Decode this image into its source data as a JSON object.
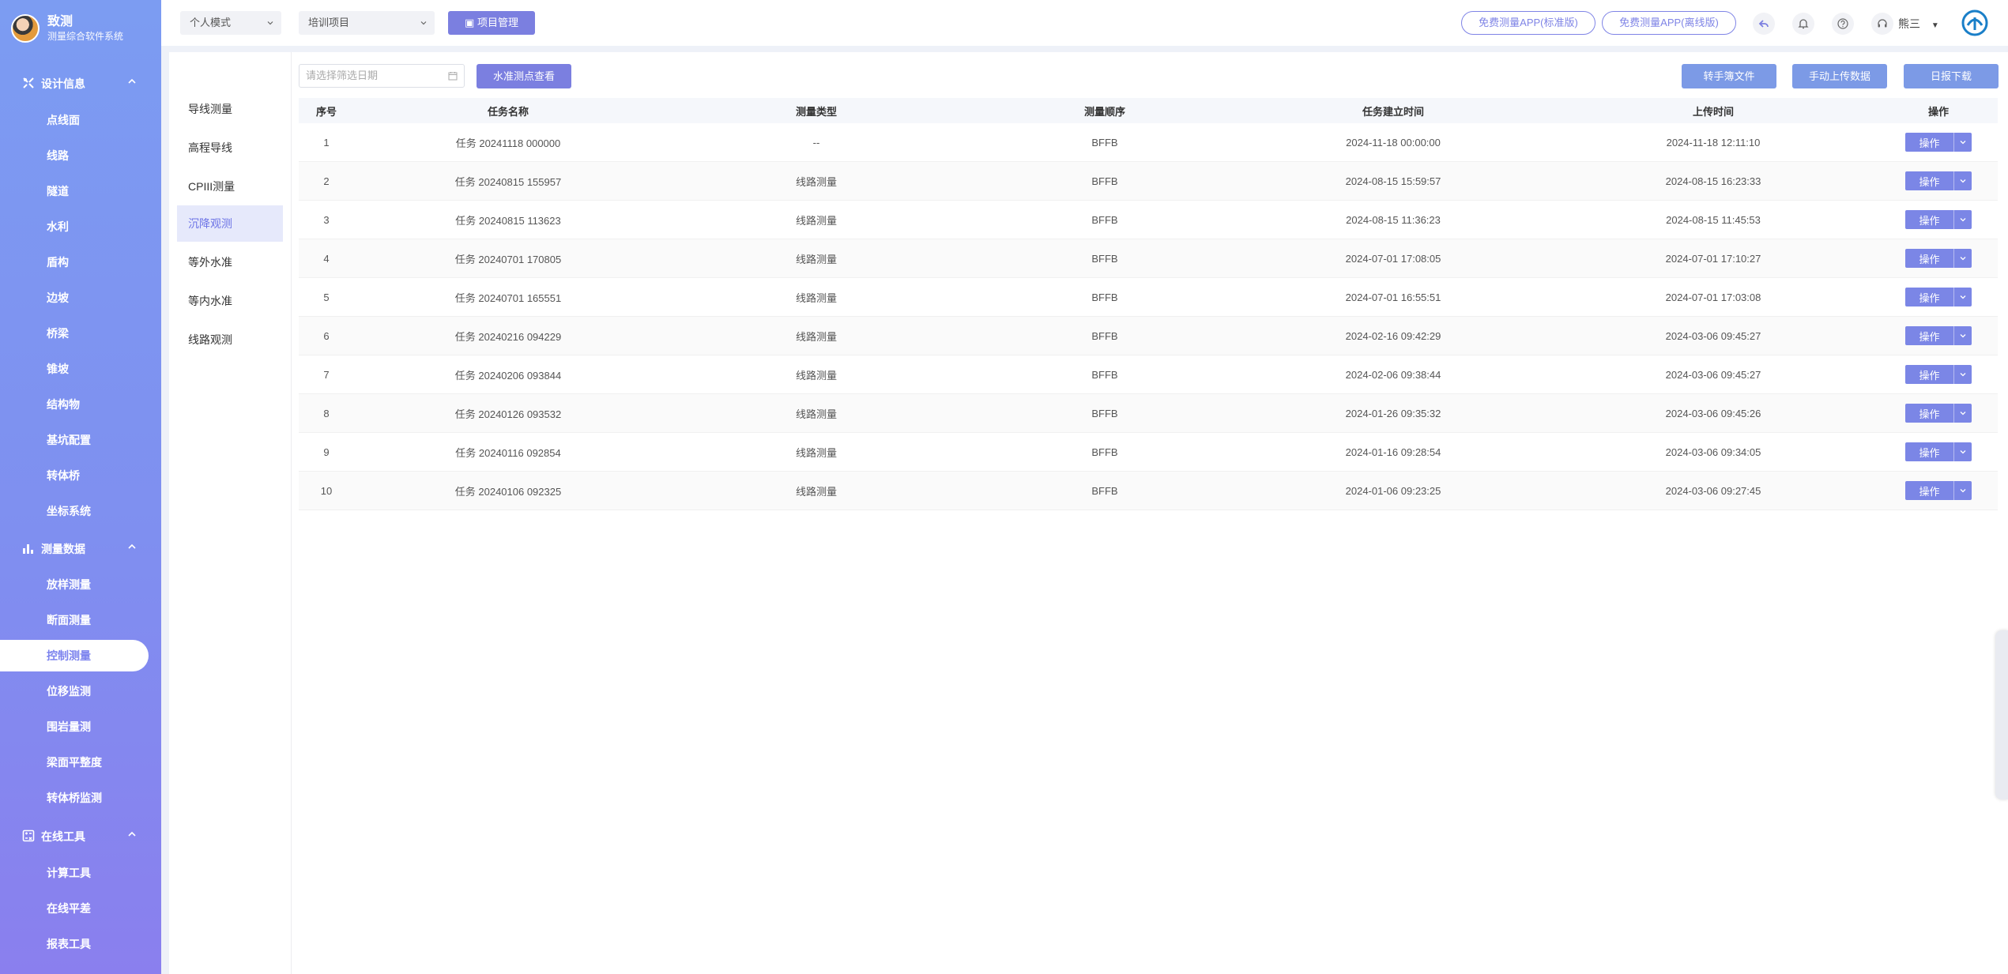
{
  "brand": {
    "name": "致测",
    "subtitle": "测量综合软件系统"
  },
  "sidebar": {
    "groups": [
      {
        "label": "设计信息",
        "items": [
          "点线面",
          "线路",
          "隧道",
          "水利",
          "盾构",
          "边坡",
          "桥梁",
          "锥坡",
          "结构物",
          "基坑配置",
          "转体桥",
          "坐标系统"
        ]
      },
      {
        "label": "测量数据",
        "items": [
          "放样测量",
          "断面测量",
          "控制测量",
          "位移监测",
          "围岩量测",
          "梁面平整度",
          "转体桥监测"
        ]
      },
      {
        "label": "在线工具",
        "items": [
          "计算工具",
          "在线平差",
          "报表工具"
        ]
      }
    ],
    "active_item": "控制测量"
  },
  "topbar": {
    "mode_select": "个人模式",
    "project_select": "培训项目",
    "project_manage_label": "项目管理",
    "app_standard_label": "免费测量APP(标准版)",
    "app_offline_label": "免费测量APP(离线版)",
    "user_name": "熊三"
  },
  "subnav": {
    "items": [
      "导线测量",
      "高程导线",
      "CPIII测量",
      "沉降观测",
      "等外水准",
      "等内水准",
      "线路观测"
    ],
    "active": "沉降观测"
  },
  "toolbar": {
    "date_placeholder": "请选择筛选日期",
    "view_points_label": "水准测点查看",
    "convert_label": "转手簿文件",
    "upload_label": "手动上传数据",
    "daily_download_label": "日报下载"
  },
  "table": {
    "headers": [
      "序号",
      "任务名称",
      "测量类型",
      "测量顺序",
      "任务建立时间",
      "上传时间",
      "操作"
    ],
    "rows": [
      [
        "1",
        "任务 20241118 000000",
        "--",
        "BFFB",
        "2024-11-18 00:00:00",
        "2024-11-18 12:11:10"
      ],
      [
        "2",
        "任务 20240815 155957",
        "线路测量",
        "BFFB",
        "2024-08-15 15:59:57",
        "2024-08-15 16:23:33"
      ],
      [
        "3",
        "任务 20240815 113623",
        "线路测量",
        "BFFB",
        "2024-08-15 11:36:23",
        "2024-08-15 11:45:53"
      ],
      [
        "4",
        "任务 20240701 170805",
        "线路测量",
        "BFFB",
        "2024-07-01 17:08:05",
        "2024-07-01 17:10:27"
      ],
      [
        "5",
        "任务 20240701 165551",
        "线路测量",
        "BFFB",
        "2024-07-01 16:55:51",
        "2024-07-01 17:03:08"
      ],
      [
        "6",
        "任务 20240216 094229",
        "线路测量",
        "BFFB",
        "2024-02-16 09:42:29",
        "2024-03-06 09:45:27"
      ],
      [
        "7",
        "任务 20240206 093844",
        "线路测量",
        "BFFB",
        "2024-02-06 09:38:44",
        "2024-03-06 09:45:27"
      ],
      [
        "8",
        "任务 20240126 093532",
        "线路测量",
        "BFFB",
        "2024-01-26 09:35:32",
        "2024-03-06 09:45:26"
      ],
      [
        "9",
        "任务 20240116 092854",
        "线路测量",
        "BFFB",
        "2024-01-16 09:28:54",
        "2024-03-06 09:34:05"
      ],
      [
        "10",
        "任务 20240106 092325",
        "线路测量",
        "BFFB",
        "2024-01-06 09:23:25",
        "2024-03-06 09:27:45"
      ]
    ],
    "op_label": "操作"
  },
  "colors": {
    "accent": "#7b7fe0",
    "sidebar_top": "#7c9cf2",
    "sidebar_bottom": "#8a7fee",
    "active_row": "#e6e9fb"
  }
}
